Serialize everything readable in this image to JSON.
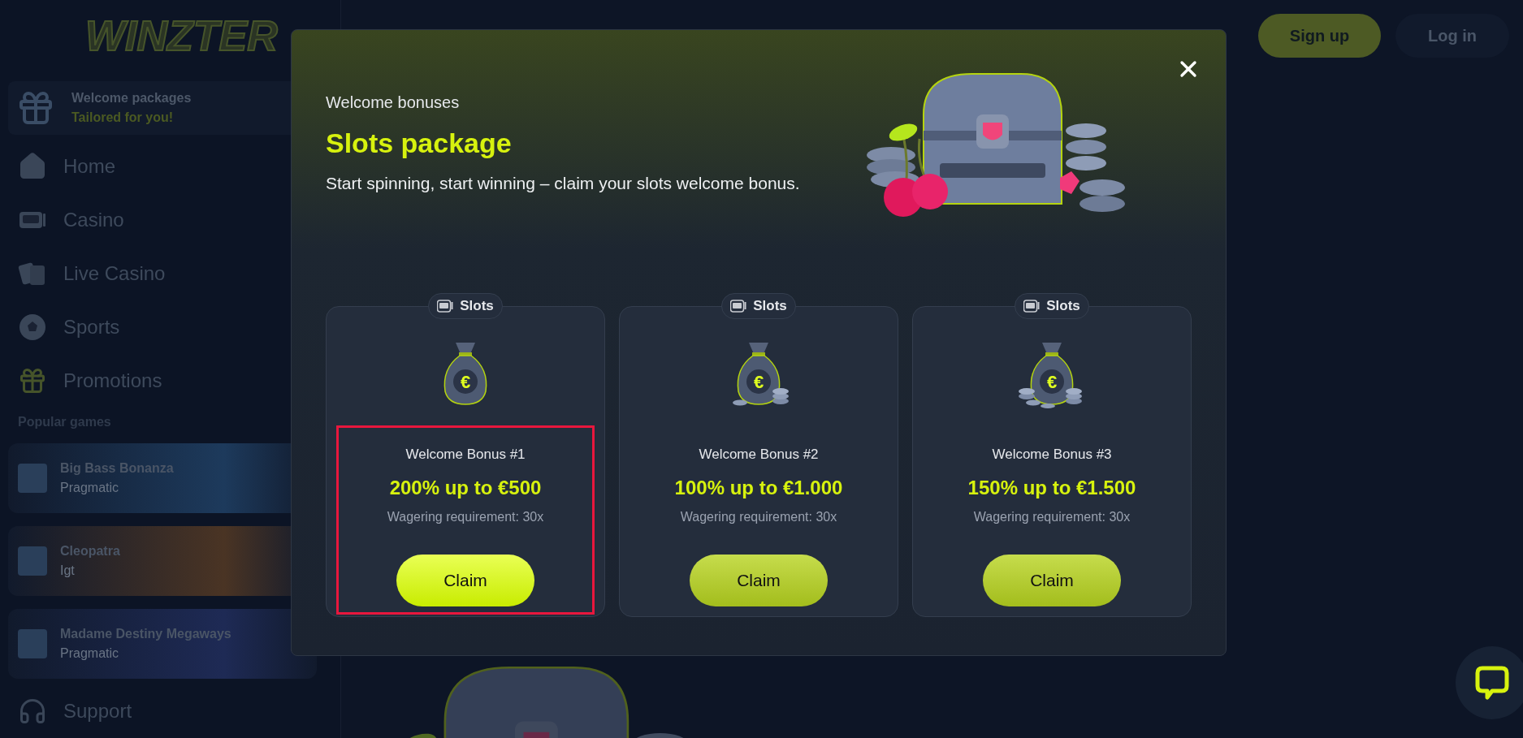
{
  "sidebar": {
    "logo": "WINZTER",
    "promo": {
      "title": "Welcome packages",
      "subtitle": "Tailored for you!"
    },
    "items": [
      {
        "label": "Home"
      },
      {
        "label": "Casino"
      },
      {
        "label": "Live Casino"
      },
      {
        "label": "Sports"
      },
      {
        "label": "Promotions"
      }
    ],
    "section_title": "Popular games",
    "games": [
      {
        "name": "Big Bass Bonanza",
        "provider": "Pragmatic",
        "color": "#1d3a5c"
      },
      {
        "name": "Cleopatra",
        "provider": "Igt",
        "color": "#4a3424"
      },
      {
        "name": "Madame Destiny Megaways",
        "provider": "Pragmatic",
        "color": "#1e2a55"
      }
    ],
    "support": "Support"
  },
  "header": {
    "buttons": [
      {
        "label": "Sign up",
        "kind": "primary"
      },
      {
        "label": "Log in",
        "kind": "secondary"
      }
    ]
  },
  "modal": {
    "eyebrow": "Welcome bonuses",
    "title": "Slots package",
    "description": "Start spinning, start winning – claim your slots welcome bonus.",
    "cards": [
      {
        "tag": "Slots",
        "title": "Welcome Bonus #1",
        "amount": "200% up to €500",
        "wagering": "Wagering requirement: 30x",
        "button": "Claim",
        "bag_label": "€",
        "highlighted": true
      },
      {
        "tag": "Slots",
        "title": "Welcome Bonus #2",
        "amount": "100% up to €1.000",
        "wagering": "Wagering requirement: 30x",
        "button": "Claim",
        "bag_label": "€",
        "highlighted": false
      },
      {
        "tag": "Slots",
        "title": "Welcome Bonus #3",
        "amount": "150% up to €1.500",
        "wagering": "Wagering requirement: 30x",
        "button": "Claim",
        "bag_label": "€",
        "highlighted": false
      }
    ]
  }
}
